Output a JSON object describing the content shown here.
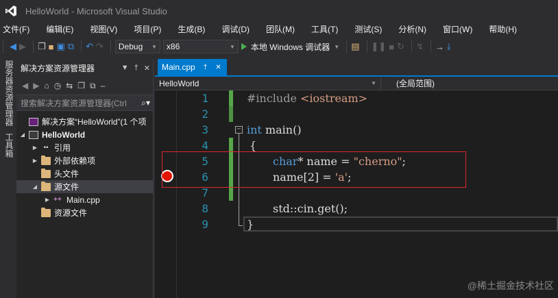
{
  "window": {
    "title": "HelloWorld - Microsoft Visual Studio"
  },
  "menu": [
    "文件(F)",
    "编辑(E)",
    "视图(V)",
    "项目(P)",
    "生成(B)",
    "调试(D)",
    "团队(M)",
    "工具(T)",
    "测试(S)",
    "分析(N)",
    "窗口(W)",
    "帮助(H)"
  ],
  "toolbar": {
    "configuration": "Debug",
    "platform": "x86",
    "run_label": "本地 Windows 调试器"
  },
  "side_tabs": [
    "服务器资源管理器",
    "工具箱"
  ],
  "solution_explorer": {
    "title": "解决方案资源管理器",
    "search_placeholder": "搜索解决方案资源管理器(Ctrl",
    "tree": [
      {
        "label": "解决方案“HelloWorld”(1 个项",
        "icon": "solution-icon",
        "level": 0
      },
      {
        "label": "HelloWorld",
        "icon": "project-icon",
        "level": 1
      },
      {
        "label": "引用",
        "icon": "references-icon",
        "level": 2
      },
      {
        "label": "外部依赖项",
        "icon": "folder-icon",
        "level": 2
      },
      {
        "label": "头文件",
        "icon": "folder-icon",
        "level": 2
      },
      {
        "label": "源文件",
        "icon": "folder-icon",
        "level": 2,
        "selected": true
      },
      {
        "label": "Main.cpp",
        "icon": "cpp-file-icon",
        "level": 3
      },
      {
        "label": "资源文件",
        "icon": "folder-icon",
        "level": 2
      }
    ]
  },
  "editor": {
    "tab_label": "Main.cpp",
    "nav_left": "HelloWorld",
    "nav_right": "(全局范围)",
    "line_numbers": [
      "1",
      "2",
      "3",
      "4",
      "5",
      "6",
      "7",
      "8",
      "9"
    ],
    "breakpoint_line": 6,
    "code": {
      "l1_pp": "#include ",
      "l1_str": "<iostream>",
      "l3_kw": "int",
      "l3_rest": " main()",
      "l4": "{",
      "l5_kw": "char",
      "l5_mid": "* name = ",
      "l5_str": "\"cherno\"",
      "l5_end": ";",
      "l6_mid": "name[2] = ",
      "l6_str": "'a'",
      "l6_end": ";",
      "l8": "std::cin.get();",
      "l9": "}"
    }
  },
  "watermark": "@稀土掘金技术社区",
  "colors": {
    "accent": "#007acc",
    "breakpoint": "#e51400",
    "line_number": "#2b91af",
    "keyword": "#569cd6",
    "string": "#d69d85",
    "preprocessor": "#9b9b9b",
    "change_bar": "#57a64a",
    "highlight_box": "#e0282c"
  }
}
